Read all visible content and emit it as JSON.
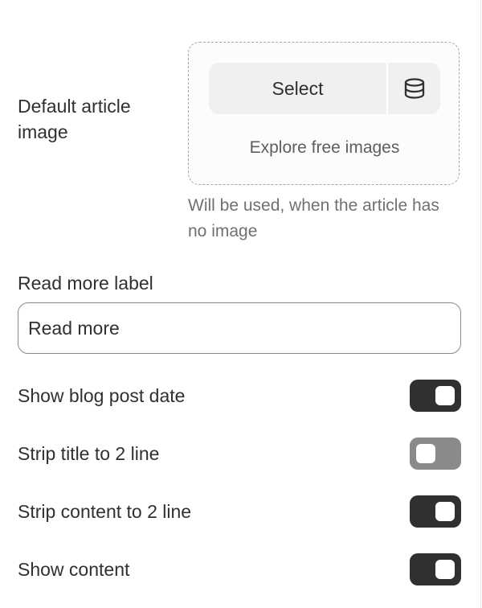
{
  "default_image": {
    "label": "Default article image",
    "select_label": "Select",
    "library_icon": "database-icon",
    "explore_label": "Explore free images",
    "help_text": "Will be used, when the article has no image"
  },
  "read_more": {
    "label": "Read more label",
    "value": "Read more"
  },
  "toggles": [
    {
      "label": "Show blog post date",
      "state": "on"
    },
    {
      "label": "Strip title to 2 line",
      "state": "off"
    },
    {
      "label": "Strip content to 2 line",
      "state": "on"
    },
    {
      "label": "Show content",
      "state": "on"
    }
  ],
  "colors": {
    "toggle_on": "#303030",
    "toggle_off": "#8a8a8a",
    "button_background": "#f0f0f0"
  }
}
